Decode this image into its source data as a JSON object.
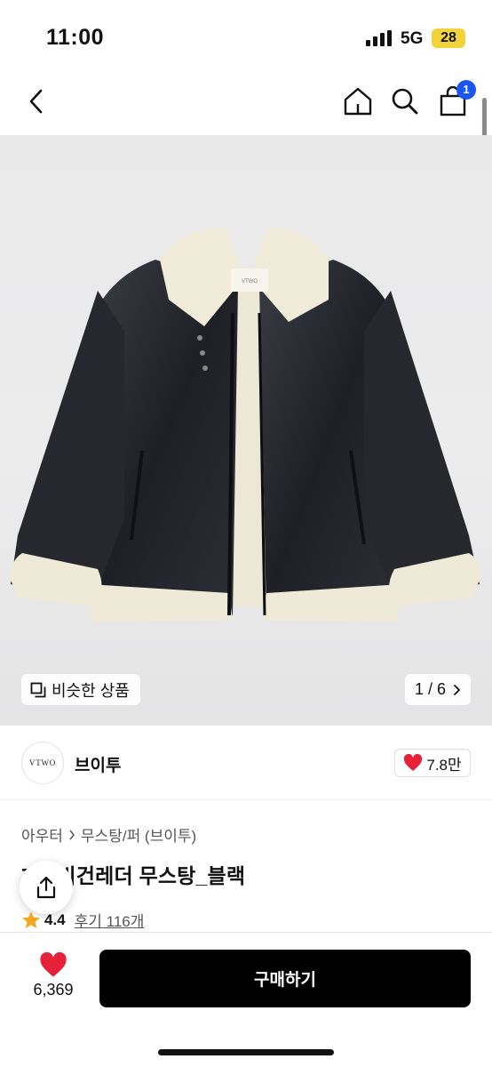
{
  "status": {
    "time": "11:00",
    "network": "5G",
    "battery": "28"
  },
  "nav": {
    "cart_count": "1",
    "icons": [
      "back-icon",
      "home-icon",
      "search-icon",
      "bag-icon"
    ]
  },
  "gallery": {
    "similar_label": "비슷한 상품",
    "pager": "1 / 6",
    "jacket_tag": "VTWO"
  },
  "brand": {
    "logo_text": "VTWO",
    "name": "브이투",
    "likes": "7.8만"
  },
  "product": {
    "breadcrumb": [
      "아우터",
      "무스탕/퍼 (브이투)"
    ],
    "title": "7-1 비건레더 무스탕_블랙",
    "rating": "4.4",
    "reviews": "후기 116개"
  },
  "bottom": {
    "wish_count": "6,369",
    "buy_label": "구매하기"
  },
  "colors": {
    "accent": "#1a56f0",
    "like": "#e8213b",
    "buy_button": "#000000",
    "star": "#f5a623"
  }
}
